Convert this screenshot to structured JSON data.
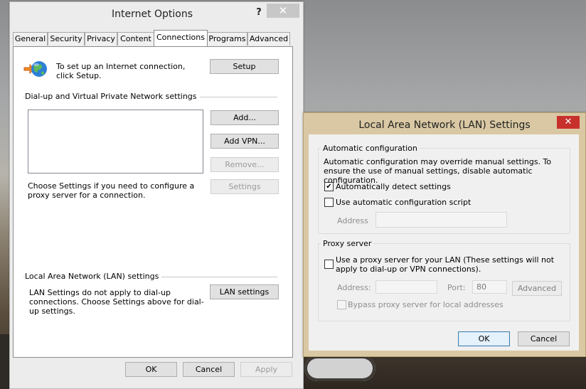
{
  "internet_options": {
    "title": "Internet Options",
    "help_glyph": "?",
    "close_glyph": "✕",
    "tabs": [
      {
        "label": "General"
      },
      {
        "label": "Security"
      },
      {
        "label": "Privacy"
      },
      {
        "label": "Content"
      },
      {
        "label": "Connections"
      },
      {
        "label": "Programs"
      },
      {
        "label": "Advanced"
      }
    ],
    "active_tab": "Connections",
    "setup_text": "To set up an Internet connection, click Setup.",
    "setup_button": "Setup",
    "dialup_group_label": "Dial-up and Virtual Private Network settings",
    "add_button": "Add...",
    "add_vpn_button": "Add VPN...",
    "remove_button": "Remove...",
    "settings_button": "Settings",
    "proxy_hint": "Choose Settings if you need to configure a proxy server for a connection.",
    "lan_group_label": "Local Area Network (LAN) settings",
    "lan_text": "LAN Settings do not apply to dial-up connections. Choose Settings above for dial-up settings.",
    "lan_settings_button": "LAN settings",
    "ok_button": "OK",
    "cancel_button": "Cancel",
    "apply_button": "Apply"
  },
  "lan_dialog": {
    "title": "Local Area Network (LAN) Settings",
    "close_glyph": "✕",
    "auto_config_label": "Automatic configuration",
    "auto_config_text": "Automatic configuration may override manual settings.  To ensure the use of manual settings, disable automatic configuration.",
    "auto_detect_label": "Automatically detect settings",
    "auto_detect_checked": true,
    "check_glyph": "✔",
    "auto_script_label": "Use automatic configuration script",
    "auto_script_checked": false,
    "address_label": "Address",
    "address_value": "",
    "proxy_group_label": "Proxy server",
    "use_proxy_label": "Use a proxy server for your LAN (These settings will not apply to dial-up or VPN connections).",
    "use_proxy_checked": false,
    "proxy_address_label": "Address:",
    "proxy_address_value": "",
    "port_label": "Port:",
    "port_value": "80",
    "advanced_button": "Advanced",
    "bypass_label": "Bypass proxy server for local addresses",
    "bypass_checked": false,
    "ok_button": "OK",
    "cancel_button": "Cancel"
  },
  "colors": {
    "lan_title_bar": "#d9c8a3",
    "lan_close": "#c8302b",
    "default_button_border": "#3c7fb1"
  }
}
